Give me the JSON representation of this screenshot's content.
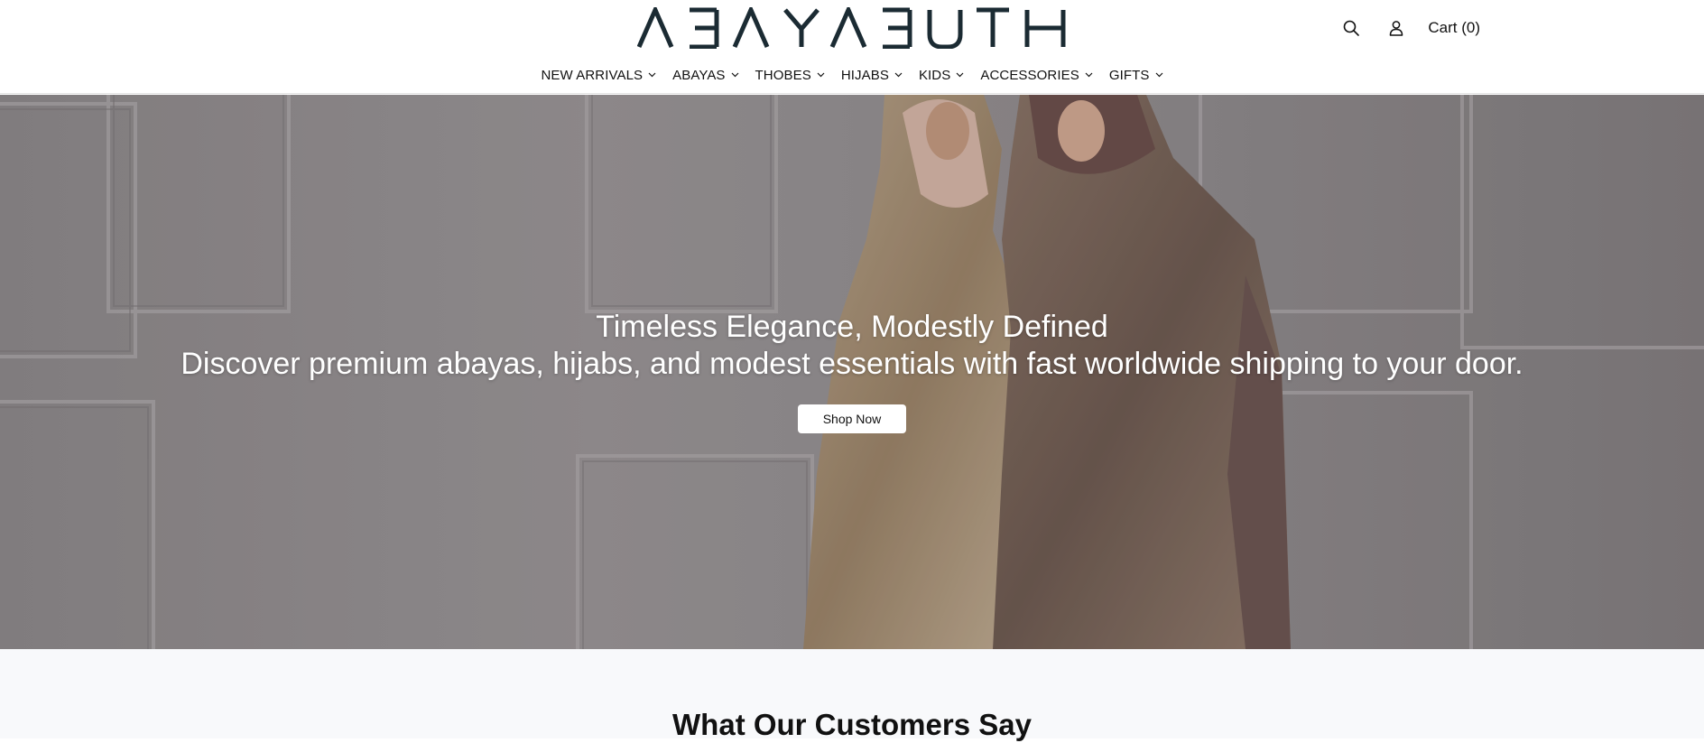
{
  "header": {
    "logo_text": "ABAYABUTH",
    "logo_color": "#1b2b33",
    "icons": {
      "search": "search-icon",
      "account": "user-icon"
    },
    "cart_label": "Cart (0)"
  },
  "nav": {
    "items": [
      {
        "label": "NEW ARRIVALS",
        "icon": "chevron-down-icon"
      },
      {
        "label": "ABAYAS",
        "icon": "chevron-down-icon"
      },
      {
        "label": "THOBES",
        "icon": "chevron-down-icon"
      },
      {
        "label": "HIJABS",
        "icon": "chevron-down-icon"
      },
      {
        "label": "KIDS",
        "icon": "chevron-down-icon"
      },
      {
        "label": "ACCESSORIES",
        "icon": "chevron-down-icon"
      },
      {
        "label": "GIFTS",
        "icon": "chevron-down-icon"
      }
    ]
  },
  "hero": {
    "title": "Timeless Elegance, Modestly Defined",
    "subtitle": "Discover premium abayas, hijabs, and modest essentials with fast worldwide shipping to your door.",
    "cta_label": "Shop Now"
  },
  "testimonials": {
    "title": "What Our Customers Say"
  },
  "colors": {
    "header_bg": "#ffffff",
    "hero_text": "#ffffff",
    "section_bg": "#f8f9fb"
  }
}
